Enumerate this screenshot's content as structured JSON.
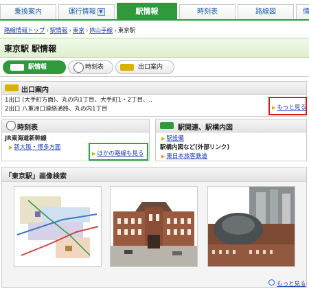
{
  "topnav": {
    "tabs": [
      "乗換案内",
      "運行情報",
      "駅情報",
      "時刻表",
      "路線図",
      "情"
    ],
    "active": "駅情報"
  },
  "breadcrumb": [
    "路線情報トップ",
    "駅情報",
    "東京",
    "JR山手線",
    "東京駅"
  ],
  "page": {
    "title": "東京駅 駅情報"
  },
  "subtabs": [
    {
      "label": "駅情報"
    },
    {
      "label": "時刻表"
    },
    {
      "label": "出口案内"
    }
  ],
  "exit": {
    "title": "出口案内",
    "line1": "1出口 (大手町方面)、丸の内1丁目、大手町1・2丁目、..",
    "line2": "2出口 八重洲口連絡通路、丸の内1丁目",
    "more": "もっと見る"
  },
  "timetable": {
    "title": "時刻表",
    "line": "JR東海道新幹線",
    "link": "新大阪・博多方面",
    "other": "ほかの路線も見る"
  },
  "related": {
    "title": "駅関連、駅構内図",
    "link1": "駅設備",
    "subtitle": "駅構内図など(外部リンク)",
    "link2": "東日本旅客鉄道"
  },
  "images": {
    "title": "「東京駅」画像検索",
    "more": "もっと見る"
  },
  "colors": {
    "brand_green": "#2f9a3c",
    "link_blue": "#1a3ca8",
    "highlight_red": "#d11a1a",
    "highlight_green": "#2aa640"
  }
}
